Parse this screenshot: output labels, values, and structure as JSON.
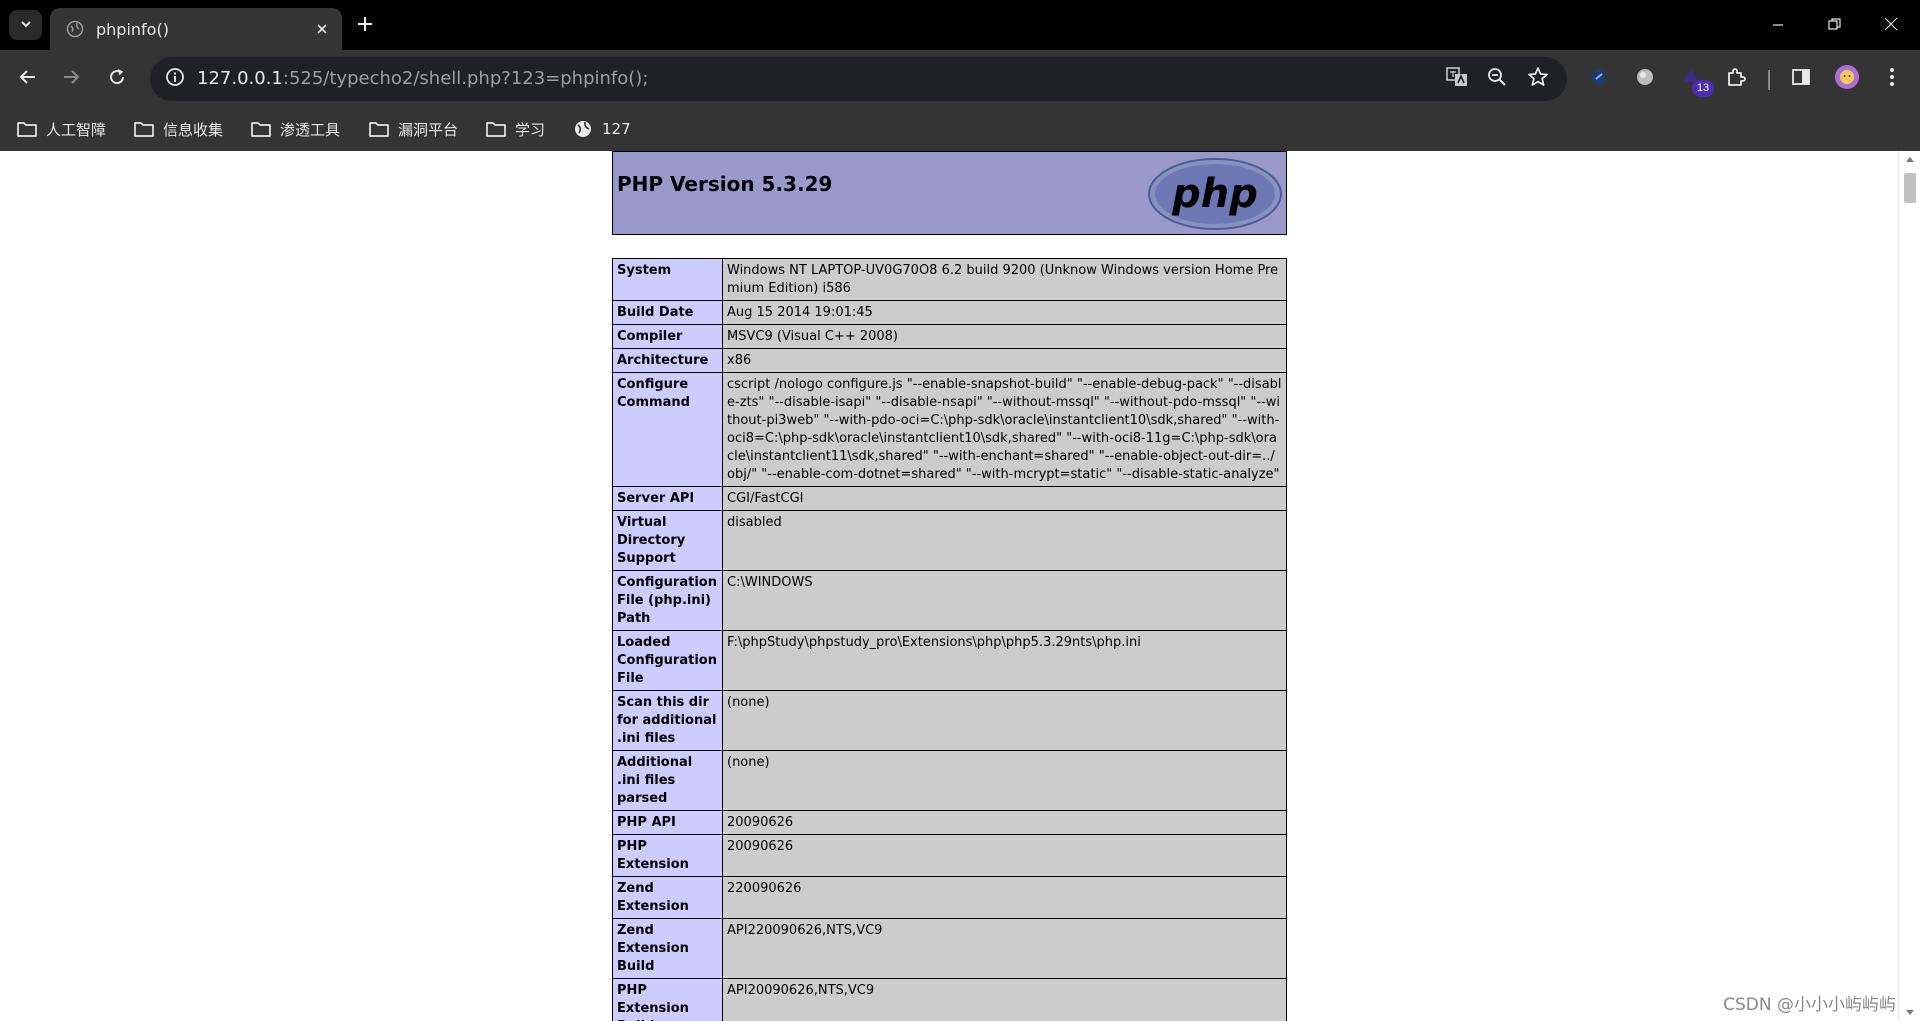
{
  "browser": {
    "tab_title": "phpinfo()",
    "url_host": "127.0.0.1",
    "url_rest": ":525/typecho2/shell.php?123=phpinfo();",
    "extension_badge": "13",
    "icons": [
      "tab-search-icon",
      "globe-icon",
      "close-icon",
      "plus-icon",
      "minimize-icon",
      "restore-icon",
      "back-arrow-icon",
      "forward-arrow-icon",
      "reload-icon",
      "info-icon",
      "translate-icon",
      "zoom-out-icon",
      "star-icon",
      "extensions-puzzle-icon",
      "side-panel-icon",
      "avatar-icon",
      "more-vertical-icon",
      "folder-icon"
    ]
  },
  "bookmarks": [
    {
      "label": "人工智障",
      "icon": "folder-icon"
    },
    {
      "label": "信息收集",
      "icon": "folder-icon"
    },
    {
      "label": "渗透工具",
      "icon": "folder-icon"
    },
    {
      "label": "漏洞平台",
      "icon": "folder-icon"
    },
    {
      "label": "学习",
      "icon": "folder-icon"
    },
    {
      "label": "127",
      "icon": "globe-icon"
    }
  ],
  "page": {
    "version_title": "PHP Version 5.3.29",
    "logo_text": "php",
    "rows": [
      {
        "key": "System",
        "value": "Windows NT LAPTOP-UV0G70O8 6.2 build 9200 (Unknow Windows version Home Premium Edition) i586"
      },
      {
        "key": "Build Date",
        "value": "Aug 15 2014 19:01:45"
      },
      {
        "key": "Compiler",
        "value": "MSVC9 (Visual C++ 2008)"
      },
      {
        "key": "Architecture",
        "value": "x86"
      },
      {
        "key": "Configure Command",
        "value": "cscript /nologo configure.js \"--enable-snapshot-build\" \"--enable-debug-pack\" \"--disable-zts\" \"--disable-isapi\" \"--disable-nsapi\" \"--without-mssql\" \"--without-pdo-mssql\" \"--without-pi3web\" \"--with-pdo-oci=C:\\php-sdk\\oracle\\instantclient10\\sdk,shared\" \"--with-oci8=C:\\php-sdk\\oracle\\instantclient10\\sdk,shared\" \"--with-oci8-11g=C:\\php-sdk\\oracle\\instantclient11\\sdk,shared\" \"--with-enchant=shared\" \"--enable-object-out-dir=../obj/\" \"--enable-com-dotnet=shared\" \"--with-mcrypt=static\" \"--disable-static-analyze\""
      },
      {
        "key": "Server API",
        "value": "CGI/FastCGI"
      },
      {
        "key": "Virtual Directory Support",
        "value": "disabled"
      },
      {
        "key": "Configuration File (php.ini) Path",
        "value": "C:\\WINDOWS"
      },
      {
        "key": "Loaded Configuration File",
        "value": "F:\\phpStudy\\phpstudy_pro\\Extensions\\php\\php5.3.29nts\\php.ini"
      },
      {
        "key": "Scan this dir for additional .ini files",
        "value": "(none)"
      },
      {
        "key": "Additional .ini files parsed",
        "value": "(none)"
      },
      {
        "key": "PHP API",
        "value": "20090626"
      },
      {
        "key": "PHP Extension",
        "value": "20090626"
      },
      {
        "key": "Zend Extension",
        "value": "220090626"
      },
      {
        "key": "Zend Extension Build",
        "value": "API220090626,NTS,VC9"
      },
      {
        "key": "PHP Extension Build",
        "value": "API20090626,NTS,VC9"
      }
    ]
  },
  "watermark": "CSDN @小小小屿屿屿"
}
